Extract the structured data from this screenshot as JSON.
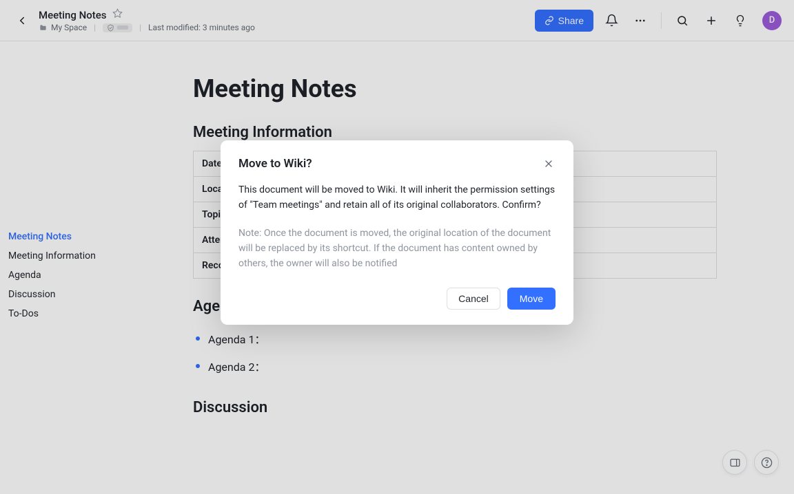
{
  "header": {
    "doc_title": "Meeting Notes",
    "space_name": "My Space",
    "last_modified": "Last modified: 3 minutes ago",
    "share_label": "Share",
    "avatar_initial": "D"
  },
  "outline": [
    {
      "label": "Meeting Notes",
      "active": true
    },
    {
      "label": "Meeting Information",
      "active": false
    },
    {
      "label": "Agenda",
      "active": false
    },
    {
      "label": "Discussion",
      "active": false
    },
    {
      "label": "To-Dos",
      "active": false
    }
  ],
  "doc": {
    "h1": "Meeting Notes",
    "section_info": "Meeting Information",
    "info_rows": [
      {
        "label": "Date",
        "value": ""
      },
      {
        "label": "Location",
        "value": ""
      },
      {
        "label": "Topic",
        "value": ""
      },
      {
        "label": "Attendees",
        "value": ""
      },
      {
        "label": "Recorder",
        "value": ""
      }
    ],
    "section_agenda": "Agenda",
    "agenda_items": [
      "Agenda 1：",
      "Agenda 2："
    ],
    "section_discussion": "Discussion"
  },
  "modal": {
    "title": "Move to Wiki?",
    "body": "This document will be moved to Wiki. It will inherit the permission settings of \"Team meetings\" and retain all of its original collaborators. Confirm?",
    "note": "Note: Once the document is moved, the original location of the document will be replaced by its shortcut. If the document has content owned by others, the owner will also be notified",
    "cancel_label": "Cancel",
    "move_label": "Move"
  }
}
